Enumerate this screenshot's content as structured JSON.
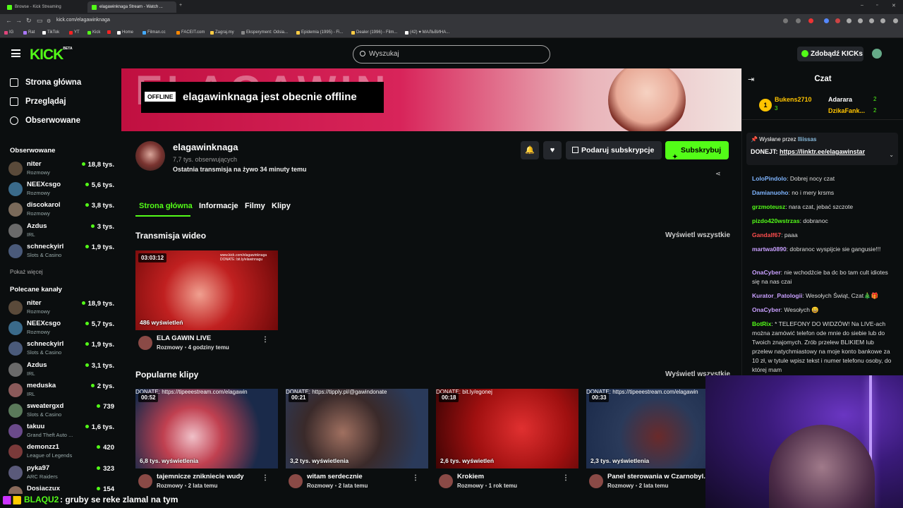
{
  "browser": {
    "tabs": [
      {
        "label": "Browse - Kick Streaming"
      },
      {
        "label": "elagawinknaga Stream - Watch ..."
      }
    ],
    "url": "kick.com/elagawinknaga",
    "bookmarks": [
      "IG",
      "Rat",
      "TikTok",
      "YT",
      "Kick",
      "",
      "Home",
      "Filman.cc",
      "FACEIT.com",
      "Zagraj.my",
      "Eksperyment: Odsia...",
      "Epidemia (1995) - Fi...",
      "Dealer (1996) - Film...",
      "(42) ♥ МАЛЬВИНА..."
    ]
  },
  "header": {
    "logo": "KICK",
    "logo_beta": "BETA",
    "search_placeholder": "Wyszukaj",
    "kicks_button": "Zdobądź KICKs"
  },
  "sidebar": {
    "nav": [
      "Strona główna",
      "Przeglądaj",
      "Obserwowane"
    ],
    "followed_title": "Obserwowane",
    "followed": [
      {
        "name": "niter",
        "category": "Rozmowy",
        "viewers": "18,8 tys.",
        "color": "#5a4a3a"
      },
      {
        "name": "NEEXcsgo",
        "category": "Rozmowy",
        "viewers": "5,6 tys.",
        "color": "#3a6a8a"
      },
      {
        "name": "discokarol",
        "category": "Rozmowy",
        "viewers": "3,8 tys.",
        "color": "#7a6a5a"
      },
      {
        "name": "Azdus",
        "category": "IRL",
        "viewers": "3 tys.",
        "color": "#6a6a6a"
      },
      {
        "name": "schneckyirl",
        "category": "Slots & Casino",
        "viewers": "1,9 tys.",
        "color": "#4a5a7a"
      }
    ],
    "show_more": "Pokaż więcej",
    "recommended_title": "Polecane kanały",
    "recommended": [
      {
        "name": "niter",
        "category": "Rozmowy",
        "viewers": "18,9 tys.",
        "color": "#5a4a3a"
      },
      {
        "name": "NEEXcsgo",
        "category": "Rozmowy",
        "viewers": "5,7 tys.",
        "color": "#3a6a8a"
      },
      {
        "name": "schneckyirl",
        "category": "Slots & Casino",
        "viewers": "1,9 tys.",
        "color": "#4a5a7a"
      },
      {
        "name": "Azdus",
        "category": "IRL",
        "viewers": "3,1 tys.",
        "color": "#6a6a6a"
      },
      {
        "name": "meduska",
        "category": "IRL",
        "viewers": "2 tys.",
        "color": "#8a5a5a"
      },
      {
        "name": "sweatergxd",
        "category": "Slots & Casino",
        "viewers": "739",
        "color": "#5a7a5a"
      },
      {
        "name": "takuu",
        "category": "Grand Theft Auto ...",
        "viewers": "1,6 tys.",
        "color": "#6a4a8a"
      },
      {
        "name": "demonzz1",
        "category": "League of Legends",
        "viewers": "420",
        "color": "#7a3a3a"
      },
      {
        "name": "pyka97",
        "category": "ARC Raiders",
        "viewers": "323",
        "color": "#5a5a7a"
      },
      {
        "name": "Dosiaczux",
        "category": "",
        "viewers": "154",
        "color": "#8a6a5a"
      }
    ]
  },
  "banner": {
    "badge": "OFFLINE",
    "text": "elagawinknaga jest obecnie offline",
    "art_text": "ELAGAWIN"
  },
  "channel": {
    "name": "elagawinknaga",
    "followers": "7,7 tys. obserwujących",
    "last_stream": "Ostatnia transmisja na żywo 34 minuty temu",
    "gift_button": "Podaruj subskrypcje",
    "subscribe_button": "Subskrybuj"
  },
  "tabs": [
    "Strona główna",
    "Informacje",
    "Filmy",
    "Klipy"
  ],
  "videos_section": {
    "title": "Transmisja wideo",
    "see_all": "Wyświetl wszystkie",
    "items": [
      {
        "duration": "03:03:12",
        "views": "486 wyświetleń",
        "title": "ELA GAWIN LIVE",
        "category": "Rozmowy",
        "age": "4 godziny temu",
        "donate": "www.kick.com/elagawinknaga DONATE: bit.ly/elawinnagu"
      }
    ]
  },
  "clips_section": {
    "title": "Popularne klipy",
    "see_all": "Wyświetl wszystkie",
    "items": [
      {
        "duration": "00:52",
        "views": "6,8 tys. wyświetlenia",
        "title": "tajemnicze znikniecie wudy",
        "category": "Rozmowy",
        "age": "2 lata temu",
        "donate": "DONATE: https://tipeeestream.com/elagawin"
      },
      {
        "duration": "00:21",
        "views": "3,2 tys. wyświetlenia",
        "title": "witam serdecznie",
        "category": "Rozmowy",
        "age": "2 lata temu",
        "donate": "DONATE: https://tipply.pl/@gawindonate"
      },
      {
        "duration": "00:18",
        "views": "2,6 tys. wyświetleń",
        "title": "Krokiem",
        "category": "Rozmowy",
        "age": "1 rok temu",
        "donate": "DONATE: bit.ly/egonej"
      },
      {
        "duration": "00:33",
        "views": "2,3 tys. wyświetlenia",
        "title": "Panel sterowania w Czarnobyl...",
        "category": "Rozmowy",
        "age": "2 lata temu",
        "donate": "DONATE: https://tipeeestream.com/elagawin"
      }
    ]
  },
  "chat": {
    "title": "Czat",
    "top_gifters": [
      {
        "rank": "1",
        "name": "Bukens2710",
        "count": "3"
      },
      {
        "name": "Adarara",
        "count": "2"
      },
      {
        "name": "DzikaFank...",
        "count": "2"
      }
    ],
    "pinned_by_label": "Wysłane przez",
    "pinned_by_user": "lliissas",
    "pinned_prefix": "DONEJT:",
    "pinned_link": "https://linktr.ee/elagawinstar",
    "messages": [
      {
        "user": "LoloPindolo",
        "color": "#7fb5ff",
        "text": ": Dobrej nocy czat"
      },
      {
        "user": "Damianuoho",
        "color": "#7fb5ff",
        "text": ": no i mery krsms"
      },
      {
        "user": "grzmoteusz",
        "color": "#53fc18",
        "text": ": nara czat, jebać szczote"
      },
      {
        "user": "pizdo420wstrzas",
        "color": "#53fc18",
        "text": ": dobranoc"
      },
      {
        "user": "Gandalf67",
        "color": "#ff4d4d",
        "text": ": paaa"
      },
      {
        "user": "martwa0890",
        "color": "#c9a0ff",
        "text": ": dobranoc wyspijcie sie gangusie!!!"
      },
      {
        "user": "OnaCyber",
        "color": "#c9a0ff",
        "text": ": nie wchodźcie ba dc bo tam cult idiotes się na nas czai"
      },
      {
        "user": "Kurator_Patologii",
        "color": "#c9a0ff",
        "text": ": Wesołych Świąt, Czat🎄🎁"
      },
      {
        "user": "OnaCyber",
        "color": "#c9a0ff",
        "text": ": Wesołych 😀"
      },
      {
        "user": "BotRix",
        "color": "#53fc18",
        "text": ": * TELEFONY DO WIDZÓW! Na LIVE-ach można zamówić telefon ode mnie do siebie lub do Twoich znajomych. Zrób przelew BLIKIEM lub przelew natychmiastowy na moje konto bankowe za 10 zł, w tytule wpisz tekst i numer telefonu osoby, do której mam"
      }
    ]
  },
  "ticker": {
    "user": "BLAQU2",
    "message": ": gruby se reke zlamal na tym"
  }
}
